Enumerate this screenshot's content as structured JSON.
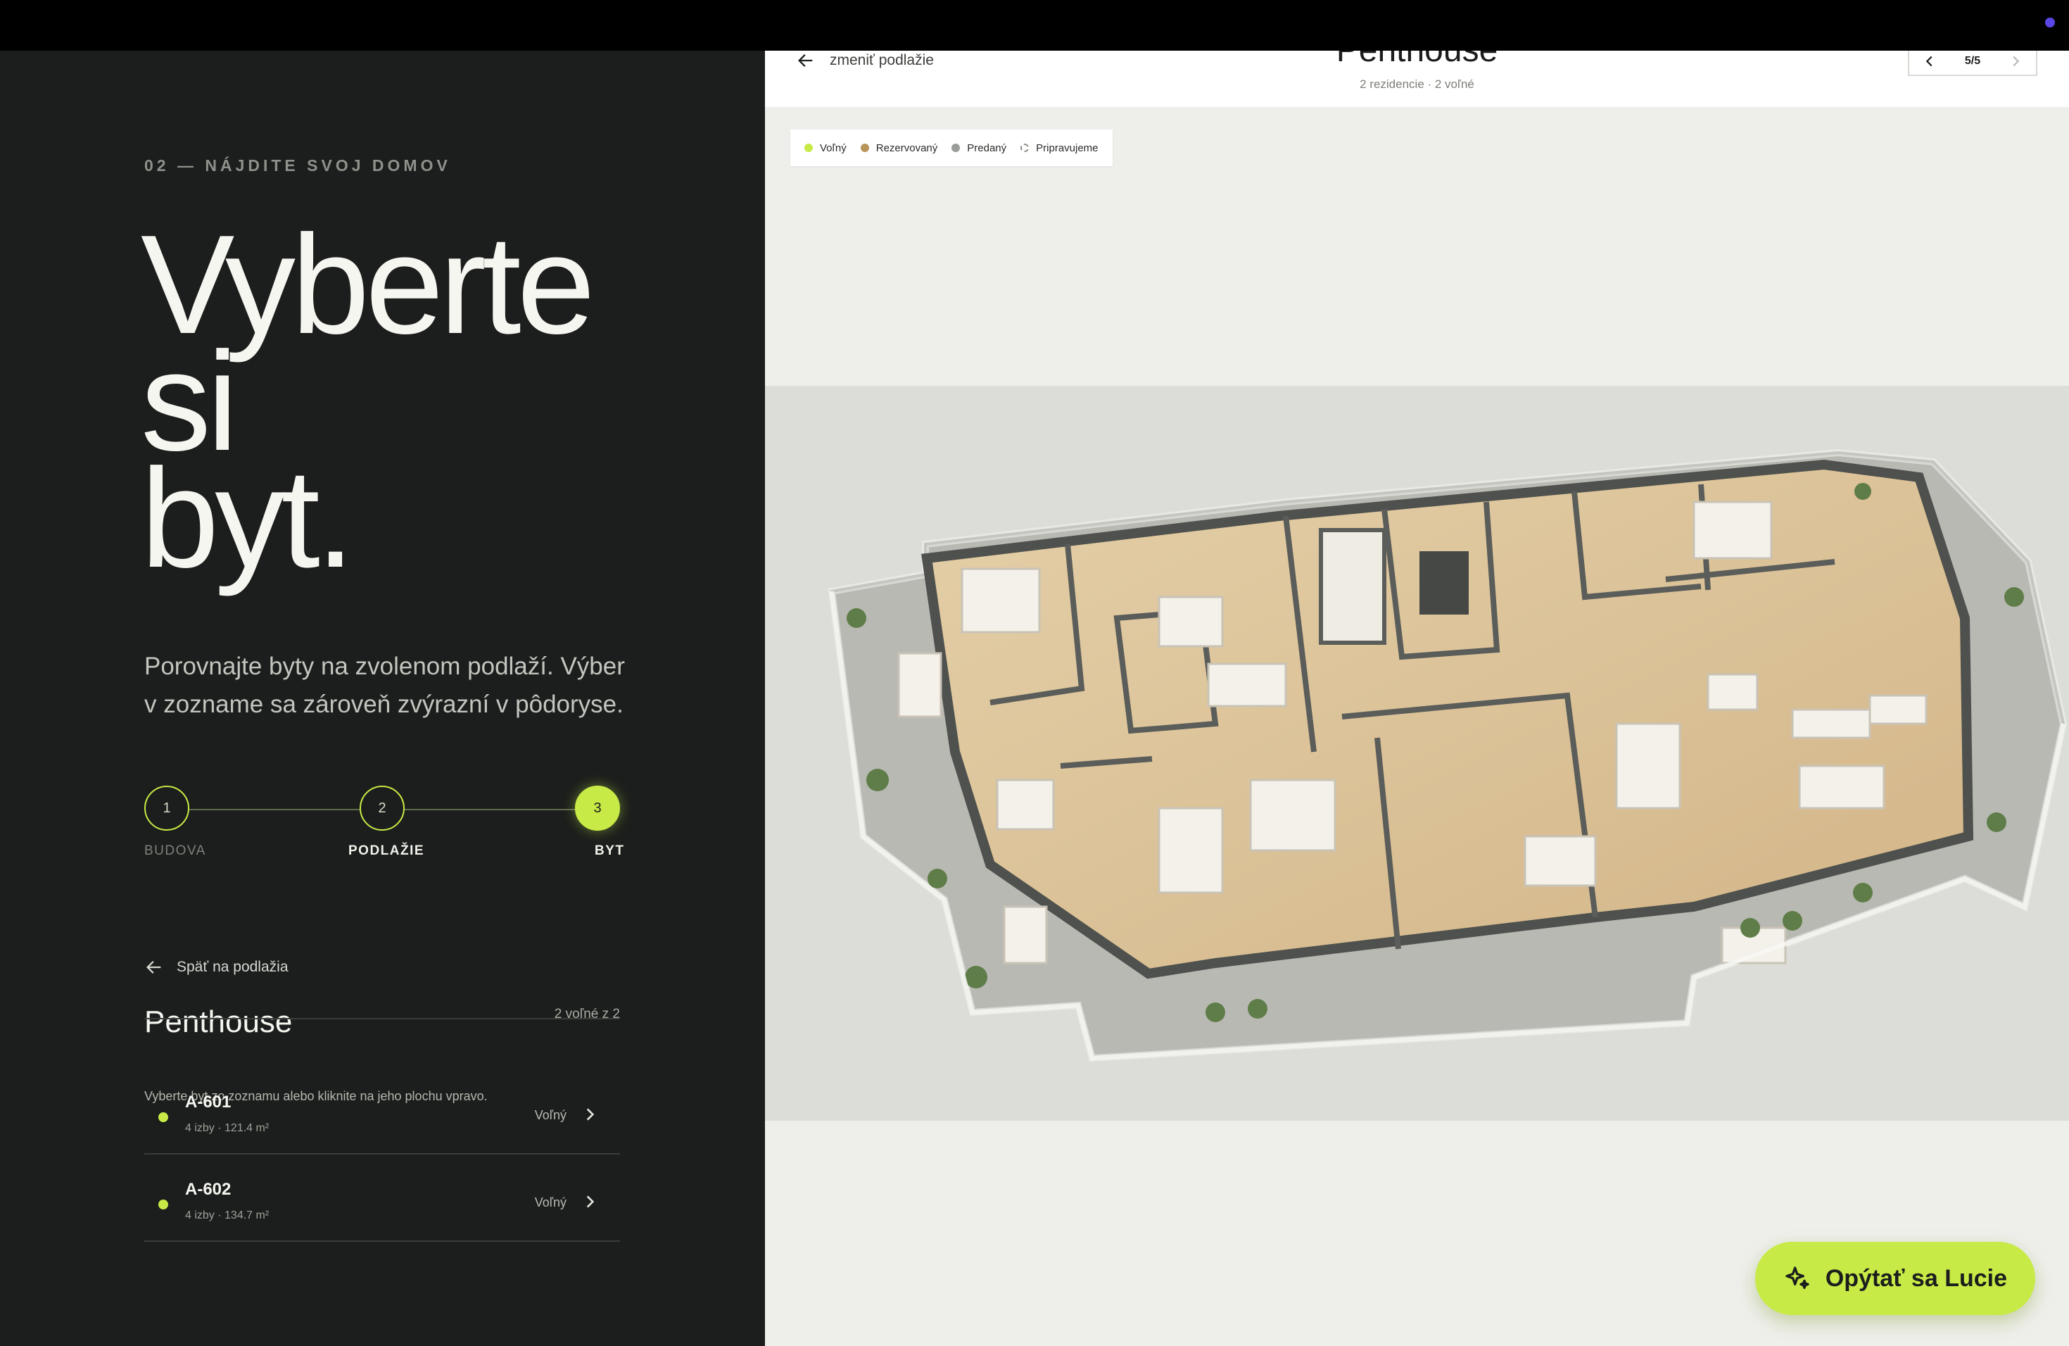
{
  "left": {
    "eyebrow": "02 — NÁJDITE SVOJ DOMOV",
    "hero_lines": [
      "Vyberte",
      "si",
      "byt."
    ],
    "intro": "Porovnajte byty na zvolenom podlaží. Výber v zozname sa zároveň zvýrazní v pôdoryse.",
    "steps": [
      {
        "number": "1",
        "label": "BUDOVA"
      },
      {
        "number": "2",
        "label": "PODLAŽIE"
      },
      {
        "number": "3",
        "label": "BYT"
      }
    ],
    "back_label": "Späť na podlažia",
    "floor_name": "Penthouse",
    "availability": "2 voľné z 2",
    "hint": "Vyberte byt zo zoznamu alebo kliknite na jeho plochu vpravo.",
    "units": [
      {
        "name": "A-601",
        "meta": "4 izby · 121.4 m²",
        "status": "Voľný"
      },
      {
        "name": "A-602",
        "meta": "4 izby · 134.7 m²",
        "status": "Voľný"
      }
    ]
  },
  "right": {
    "change_floor": "zmeniť podlažie",
    "title": "Penthouse",
    "subtitle": "2 rezidencie · 2 voľné",
    "pager": "5/5",
    "legend": [
      {
        "label": "Voľný",
        "color": "#c7ea46"
      },
      {
        "label": "Rezervovaný",
        "color": "#b8955a"
      },
      {
        "label": "Predaný",
        "color": "#9a9c97"
      },
      {
        "label": "Pripravujeme",
        "color": "#8d9088"
      }
    ]
  },
  "cta_label": "Opýtať sa Lucie",
  "colors": {
    "accent": "#c7ea46",
    "panel": "#1b1e1c"
  }
}
